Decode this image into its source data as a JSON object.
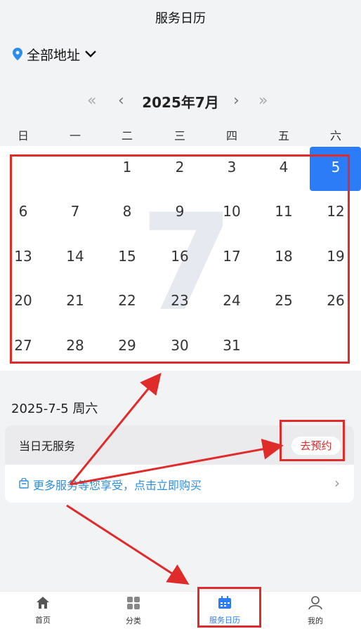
{
  "header": {
    "title": "服务日历"
  },
  "location": {
    "label": "全部地址",
    "pin_icon": "location-pin-icon",
    "pin_color": "#2b8cf0"
  },
  "month_nav": {
    "prev_year": "«",
    "prev_month": "‹",
    "title": "2025年7月",
    "next_month": "›",
    "next_year": "»"
  },
  "weekdays": [
    "日",
    "一",
    "二",
    "三",
    "四",
    "五",
    "六"
  ],
  "calendar": {
    "watermark": "7",
    "selected_day": "5",
    "rows": [
      [
        "",
        "",
        "1",
        "2",
        "3",
        "4",
        "5"
      ],
      [
        "6",
        "7",
        "8",
        "9",
        "10",
        "11",
        "12"
      ],
      [
        "13",
        "14",
        "15",
        "16",
        "17",
        "18",
        "19"
      ],
      [
        "20",
        "21",
        "22",
        "23",
        "24",
        "25",
        "26"
      ],
      [
        "27",
        "28",
        "29",
        "30",
        "31",
        "",
        ""
      ]
    ]
  },
  "selected": {
    "date_text": "2025-7-5 周六"
  },
  "service": {
    "none_text": "当日无服务",
    "book_label": "去预约",
    "promo_text": "更多服务等您享受，点击立即购买",
    "promo_arrow": "›"
  },
  "tabbar": {
    "items": [
      {
        "label": "首页",
        "icon": "home-icon"
      },
      {
        "label": "分类",
        "icon": "grid-icon"
      },
      {
        "label": "服务日历",
        "icon": "calendar-icon",
        "active": true
      },
      {
        "label": "我的",
        "icon": "user-icon"
      }
    ]
  },
  "colors": {
    "accent": "#2b7cf6",
    "annotation": "#e02b2b",
    "promo": "#2e8ed8"
  }
}
